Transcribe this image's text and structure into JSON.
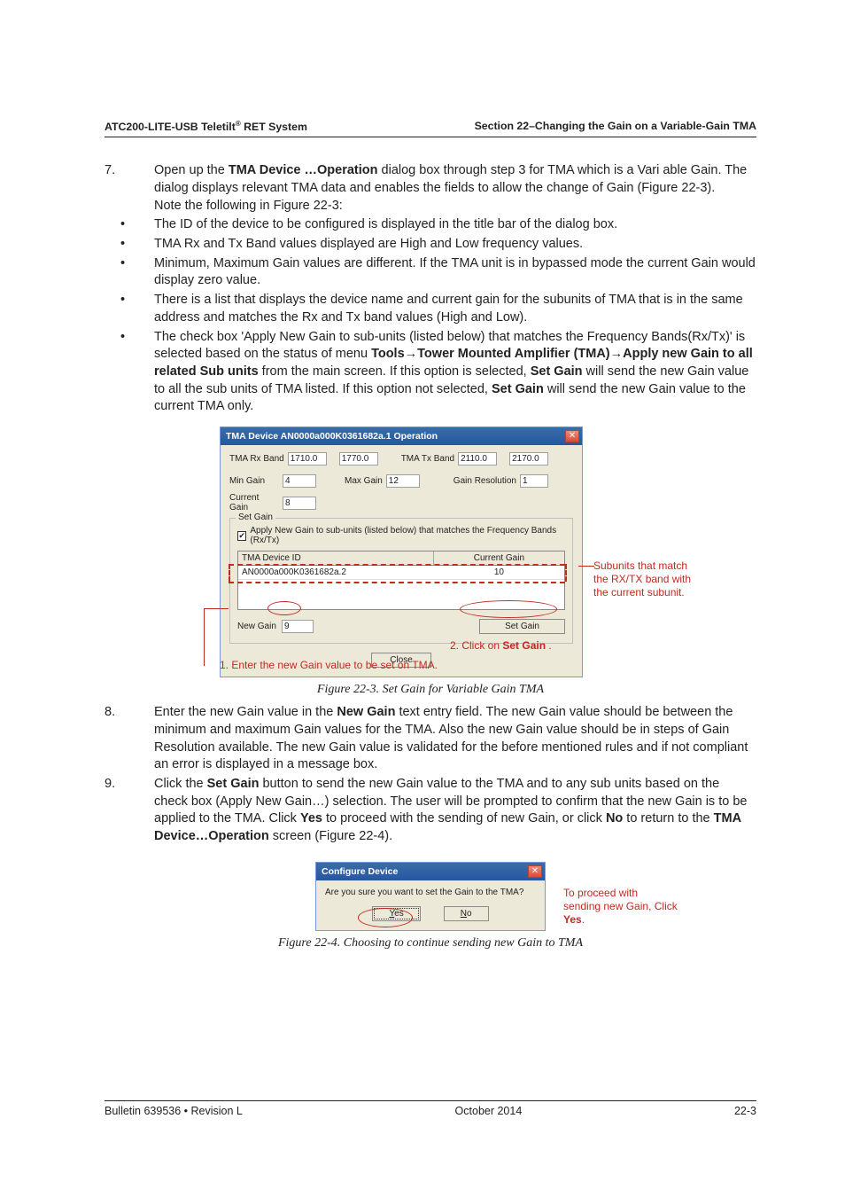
{
  "header": {
    "left": "ATC200-LITE-USB Teletilt® RET System",
    "right": "Section 22–Changing the Gain on a Variable-Gain TMA"
  },
  "steps": {
    "s7num": "7.",
    "s7a": "Open up the ",
    "s7b": "TMA Device …Operation",
    "s7c": " dialog box through step 3 for TMA which is a Vari able Gain. The dialog displays relevant TMA data and enables the fields to allow the change of Gain (Figure 22-3).",
    "s7note": "Note the following in Figure 22-3:",
    "b1": "The ID of the device to be configured is displayed in the title bar of the dialog box.",
    "b2": "TMA Rx and Tx Band values displayed are High and Low frequency values.",
    "b3": "Minimum, Maximum Gain values are different. If the TMA unit is in bypassed mode the current Gain would display zero value.",
    "b4": "There is a list that displays the device name and current gain for the subunits of TMA that is in the same address and matches the Rx and Tx band values (High and Low).",
    "b5a": "The check box 'Apply New Gain to sub-units (listed below) that matches the Frequency Bands(Rx/Tx)' is selected based on the status of menu ",
    "b5b": "Tools→Tower Mounted Amplifier (TMA)→Apply new Gain to all related Sub units",
    "b5c": " from the main screen. If this option is selected, ",
    "b5d": "Set Gain",
    "b5e": " will send the new Gain value to all the sub units of TMA listed. If this option not selected, ",
    "b5f": "Set Gain",
    "b5g": " will send the new Gain value to the current TMA only.",
    "s8num": "8.",
    "s8a": "Enter the new Gain value in the ",
    "s8b": "New Gain",
    "s8c": " text entry field. The new Gain value should be between the minimum and maximum Gain values for the TMA. Also the new Gain value should be in steps of Gain Resolution available. The new Gain value is validated for the before mentioned rules and if not compliant an error is displayed in a message box.",
    "s9num": "9.",
    "s9a": "Click the ",
    "s9b": "Set Gain",
    "s9c": " button to send the new Gain value to the TMA and to any sub units based on the check box (Apply New Gain…) selection. The user will be prompted to confirm that the new Gain is to be applied to the TMA. Click ",
    "s9d": "Yes",
    "s9e": " to proceed with the sending of new Gain, or click ",
    "s9f": "No",
    "s9g": " to return to the ",
    "s9h": "TMA Device…Operation",
    "s9i": " screen (Figure 22-4)."
  },
  "dialog1": {
    "title": "TMA Device AN0000a000K0361682a.1 Operation",
    "rx_label": "TMA Rx Band",
    "rx_lo": "1710.0",
    "rx_hi": "1770.0",
    "tx_label": "TMA Tx Band",
    "tx_lo": "2110.0",
    "tx_hi": "2170.0",
    "min_label": "Min Gain",
    "min_val": "4",
    "max_label": "Max Gain",
    "max_val": "12",
    "res_label": "Gain Resolution",
    "res_val": "1",
    "cur_label": "Current Gain",
    "cur_val": "8",
    "legend": "Set Gain",
    "chk_label": "Apply New Gain to sub-units (listed below) that matches the Frequency Bands (Rx/Tx)",
    "col1": "TMA Device ID",
    "col2": "Current Gain",
    "row_id": "AN0000a000K0361682a.2",
    "row_gain": "10",
    "newgain_label": "New Gain",
    "newgain_val": "9",
    "setgain_btn": "Set Gain",
    "close_btn": "Close"
  },
  "callouts": {
    "subunits_l1": "Subunits that match",
    "subunits_l2": "the RX/TX band with",
    "subunits_l3": "the current subunit.",
    "setgain_note_a": "2.  Click on ",
    "setgain_note_b": "Set Gain",
    "setgain_note_c": " .",
    "newgain_note": "1.  Enter the new Gain value to be set on TMA."
  },
  "fig1_caption": "Figure 22-3. Set Gain for Variable Gain TMA",
  "dialog2": {
    "title": "Configure Device",
    "msg": "Are you sure you want to set the Gain to the TMA?",
    "yes": "Yes",
    "no": "No"
  },
  "callouts2": {
    "l1": "To proceed with",
    "l2": "sending new Gain, Click",
    "l3": "Yes",
    "l3b": "."
  },
  "fig2_caption": "Figure 22-4. Choosing to continue sending new Gain to TMA",
  "footer": {
    "left": "Bulletin 639536  •  Revision L",
    "center": "October 2014",
    "right": "22-3"
  }
}
